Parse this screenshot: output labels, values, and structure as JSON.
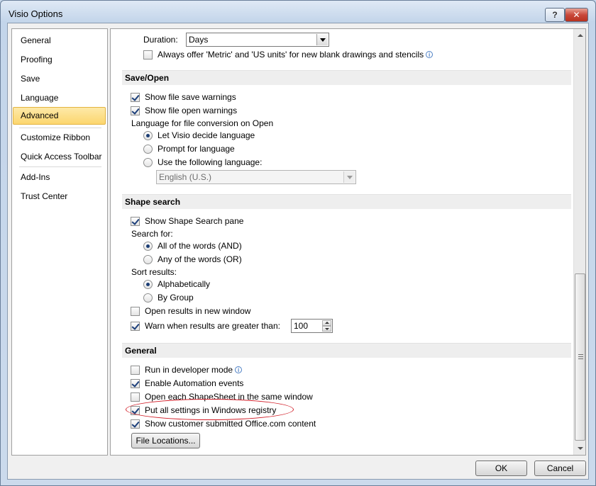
{
  "window": {
    "title": "Visio Options",
    "help_label": "?",
    "close_label": "✕"
  },
  "nav": {
    "items": [
      {
        "label": "General"
      },
      {
        "label": "Proofing"
      },
      {
        "label": "Save"
      },
      {
        "label": "Language"
      },
      {
        "label": "Advanced",
        "selected": true
      },
      {
        "label": "Customize Ribbon"
      },
      {
        "label": "Quick Access Toolbar"
      },
      {
        "label": "Add-Ins"
      },
      {
        "label": "Trust Center"
      }
    ]
  },
  "top_options": {
    "duration_label": "Duration:",
    "duration_value": "Days",
    "metric_label": "Always offer 'Metric' and 'US units' for new blank drawings and stencils",
    "metric_checked": false
  },
  "save_open": {
    "header": "Save/Open",
    "show_save_warnings": {
      "label": "Show file save warnings",
      "checked": true
    },
    "show_open_warnings": {
      "label": "Show file open warnings",
      "checked": true
    },
    "language_group_label": "Language for file conversion on Open",
    "radio_let_visio": {
      "label": "Let Visio decide language",
      "checked": true
    },
    "radio_prompt": {
      "label": "Prompt for language",
      "checked": false
    },
    "radio_use_following": {
      "label": "Use the following language:",
      "checked": false
    },
    "language_value": "English (U.S.)"
  },
  "shape_search": {
    "header": "Shape search",
    "show_pane": {
      "label": "Show Shape Search pane",
      "checked": true
    },
    "search_for_label": "Search for:",
    "radio_all_words": {
      "label": "All of the words (AND)",
      "checked": true
    },
    "radio_any_words": {
      "label": "Any of the words (OR)",
      "checked": false
    },
    "sort_results_label": "Sort results:",
    "radio_alpha": {
      "label": "Alphabetically",
      "checked": true
    },
    "radio_group": {
      "label": "By Group",
      "checked": false
    },
    "open_new_window": {
      "label": "Open results in new window",
      "checked": false
    },
    "warn_results": {
      "label": "Warn when results are greater than:",
      "checked": true
    },
    "warn_value": "100"
  },
  "general": {
    "header": "General",
    "developer_mode": {
      "label": "Run in developer mode",
      "checked": false
    },
    "automation_events": {
      "label": "Enable Automation events",
      "checked": true
    },
    "shapesheet_same_window": {
      "label": "Open each ShapeSheet in the same window",
      "checked": false
    },
    "windows_registry": {
      "label": "Put all settings in Windows registry",
      "checked": true
    },
    "customer_content": {
      "label": "Show customer submitted Office.com content",
      "checked": true
    },
    "file_locations_label": "File Locations..."
  },
  "footer": {
    "ok_label": "OK",
    "cancel_label": "Cancel"
  },
  "colors": {
    "highlight_ellipse": "#d2202a",
    "selected_nav": "#fcd66e"
  }
}
